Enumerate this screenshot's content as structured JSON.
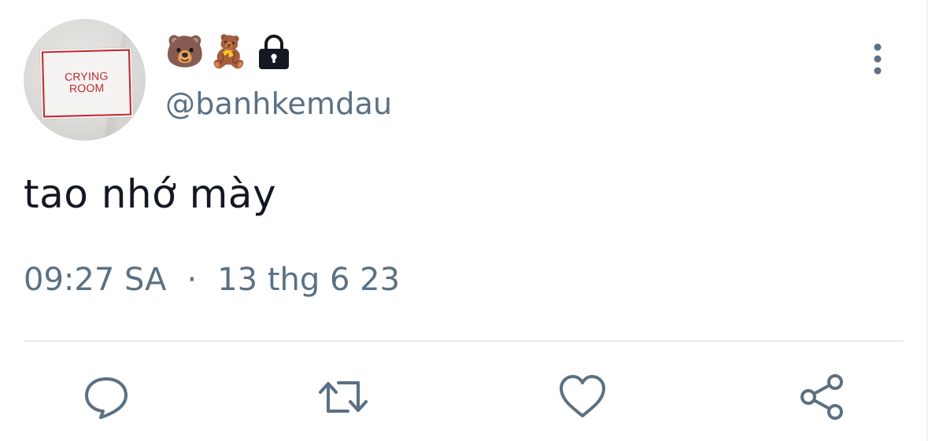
{
  "author": {
    "display_name_emojis": [
      "🐻",
      "🧸"
    ],
    "protected_icon": "lock-icon",
    "handle": "@banhkemdau",
    "avatar_sign_text": "CRYING\nROOM"
  },
  "tweet": {
    "text": "tao nhớ mày",
    "time": "09:27 SA",
    "separator": "·",
    "date": "13 thg 6 23"
  },
  "actions": {
    "reply_icon": "reply-icon",
    "retweet_icon": "retweet-icon",
    "like_icon": "heart-icon",
    "share_icon": "share-icon"
  },
  "menu": {
    "icon": "more-vertical-icon"
  },
  "colors": {
    "secondary_text": "#5b7083",
    "primary_text": "#141823",
    "divider": "#e6ecf0",
    "sign_red": "#c0272d"
  }
}
